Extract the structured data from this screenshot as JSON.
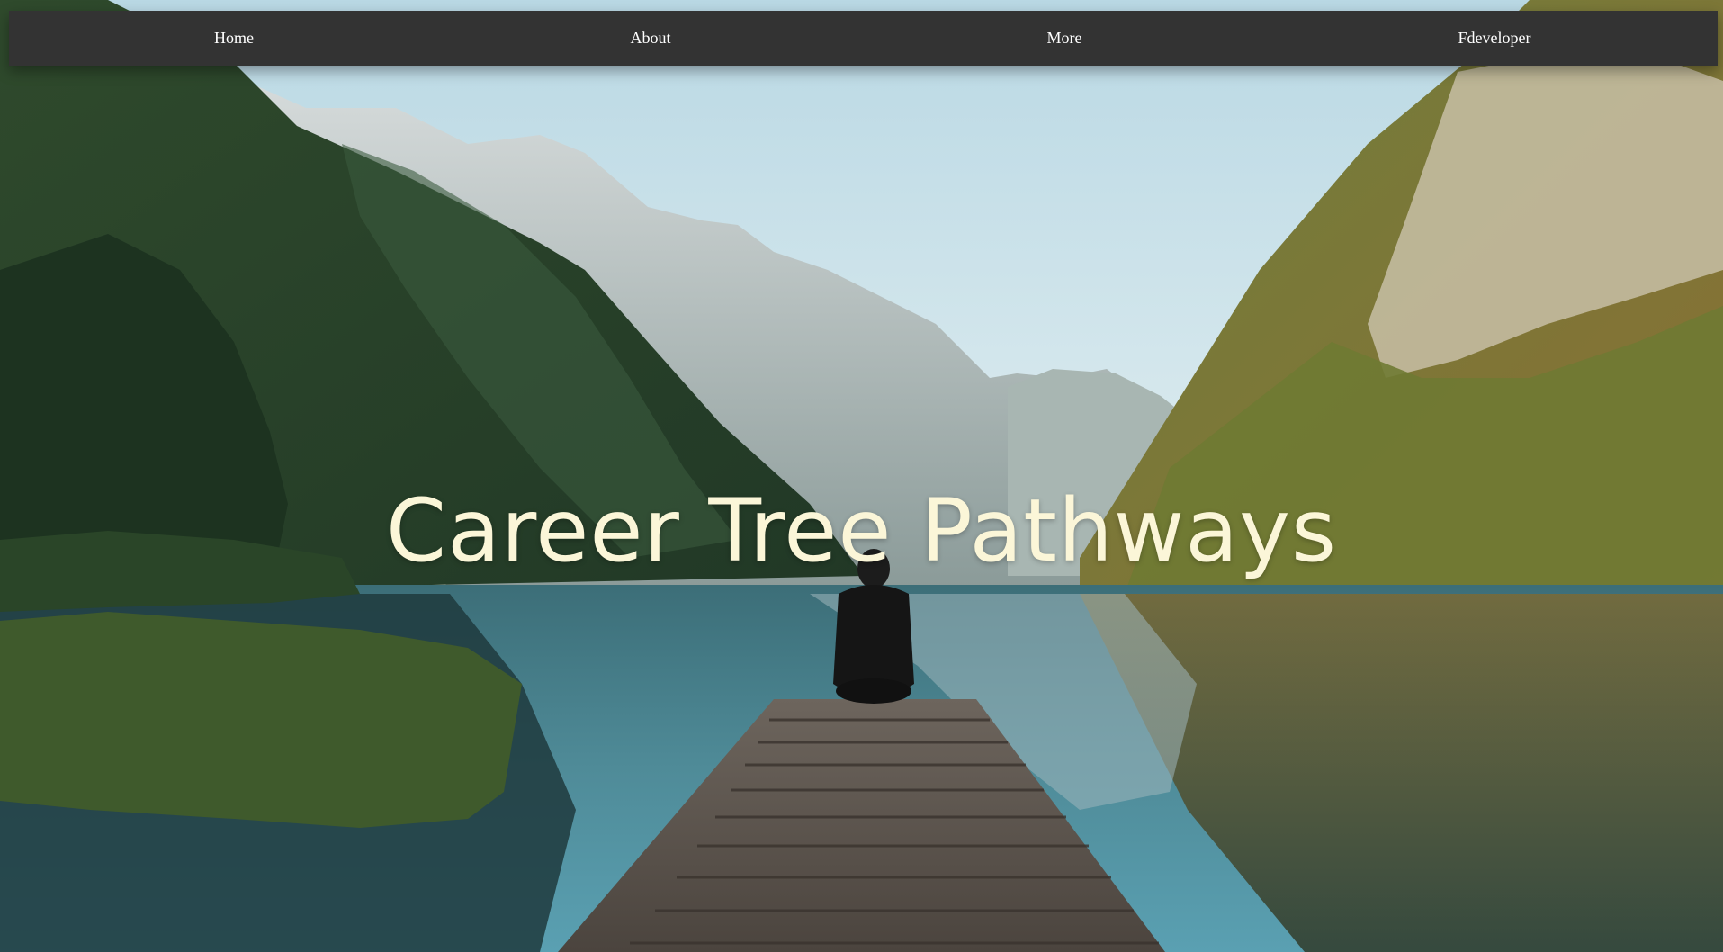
{
  "nav": {
    "items": [
      {
        "label": "Home"
      },
      {
        "label": "About"
      },
      {
        "label": "More"
      },
      {
        "label": "Fdeveloper"
      }
    ]
  },
  "hero": {
    "title": "Career Tree Pathways",
    "background": "mountain-lake-with-person-on-dock-photo"
  },
  "colors": {
    "navbar": "#333333",
    "nav_text": "#ffffff",
    "title": "#fbf6d8"
  }
}
